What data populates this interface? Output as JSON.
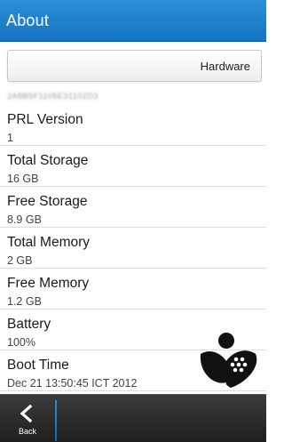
{
  "header": {
    "title": "About"
  },
  "dropdown": {
    "selected": "Hardware"
  },
  "blurred_id": "2A8B5F1105E31102D3",
  "info": [
    {
      "label": "PRL Version",
      "value": "1"
    },
    {
      "label": "Total Storage",
      "value": "16 GB"
    },
    {
      "label": "Free Storage",
      "value": "8.9 GB"
    },
    {
      "label": "Total Memory",
      "value": "2 GB"
    },
    {
      "label": "Free Memory",
      "value": "1.2 GB"
    },
    {
      "label": "Battery",
      "value": "100%"
    },
    {
      "label": "Boot Time",
      "value": "Dec 21 13:50:45 ICT 2012"
    }
  ],
  "actionbar": {
    "back_label": "Back"
  },
  "colors": {
    "titlebar": "#1574c2",
    "actionbar": "#2a2a2a",
    "accent": "#2a8fd6"
  },
  "icons": {
    "back": "chevron-left-icon",
    "logo": "blackberry-logo"
  }
}
